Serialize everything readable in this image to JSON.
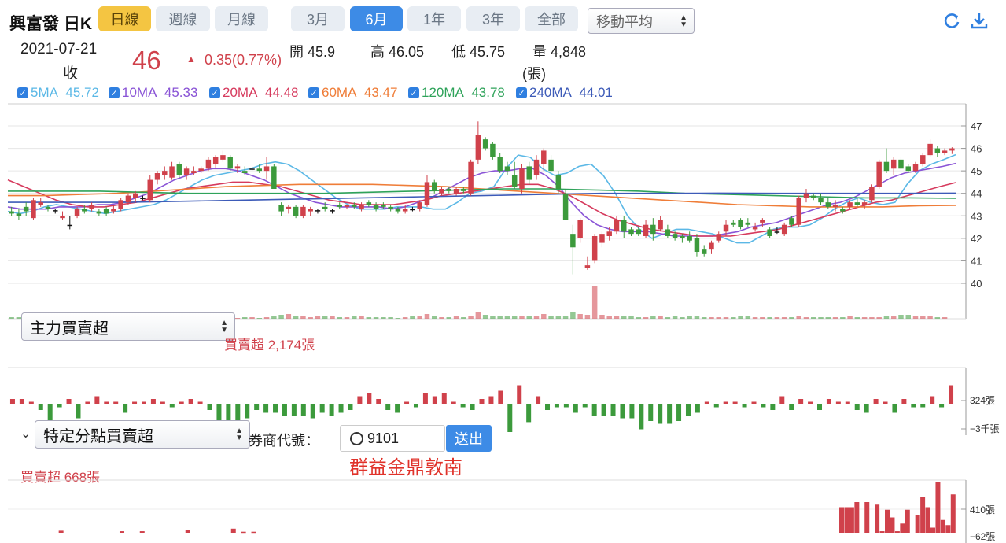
{
  "header": {
    "stock_name": "興富發 日K",
    "ranges": [
      "日線",
      "週線",
      "月線"
    ],
    "periods": [
      "3月",
      "6月",
      "1年",
      "3年",
      "全部"
    ],
    "indicator_select": "移動平均"
  },
  "quote": {
    "date": "2021-07-21",
    "close_label": "收",
    "price": "46",
    "change": "0.35(0.77%)",
    "open": "開 45.9",
    "high": "高 46.05",
    "low": "低 45.75",
    "volume": "量 4,848",
    "volume_unit": "(張)"
  },
  "ma_legend": [
    {
      "label": "5MA",
      "value": "45.72",
      "color": "#5bb8e6"
    },
    {
      "label": "10MA",
      "value": "45.33",
      "color": "#8a54d6"
    },
    {
      "label": "20MA",
      "value": "44.48",
      "color": "#d63a5d"
    },
    {
      "label": "60MA",
      "value": "43.47",
      "color": "#ef7d38"
    },
    {
      "label": "120MA",
      "value": "43.78",
      "color": "#2fa35a"
    },
    {
      "label": "240MA",
      "value": "44.01",
      "color": "#3d5bb8"
    }
  ],
  "price_axis": [
    "47",
    "46",
    "45",
    "44",
    "43",
    "42",
    "41",
    "40"
  ],
  "main_force": {
    "select": "主力買賣超",
    "summary": "買賣超 2,174張",
    "axis_top": "324張",
    "axis_bottom": "−3千張"
  },
  "branch": {
    "select": "特定分點買賣超",
    "broker_label": "券商代號：",
    "broker_code": "9101",
    "submit": "送出",
    "broker_name": "群益金鼎敦南",
    "summary": "買賣超 668張",
    "axis_top": "410張",
    "axis_bottom": "−62張"
  },
  "colors": {
    "up": "#d0414b",
    "down": "#3c9a3c",
    "accent": "#3d8be6"
  },
  "chart_data": {
    "type": "candlestick",
    "ylim": [
      40,
      47
    ],
    "candles": [
      [
        43.2,
        43.4,
        43.0,
        43.1
      ],
      [
        43.1,
        43.3,
        42.8,
        43.0
      ],
      [
        43.4,
        43.6,
        43.0,
        43.2
      ],
      [
        42.9,
        43.8,
        42.8,
        43.7
      ],
      [
        43.5,
        43.8,
        43.4,
        43.6
      ],
      [
        43.4,
        43.5,
        43.2,
        43.3
      ],
      [
        43.2,
        43.3,
        43.1,
        43.25
      ],
      [
        42.9,
        43.2,
        42.8,
        43.0
      ],
      [
        42.6,
        43.0,
        42.4,
        42.6
      ],
      [
        43.0,
        43.4,
        42.9,
        43.3
      ],
      [
        43.3,
        43.5,
        43.1,
        43.2
      ],
      [
        43.3,
        43.6,
        43.2,
        43.5
      ],
      [
        43.2,
        43.3,
        43.0,
        43.1
      ],
      [
        43.3,
        43.4,
        43.0,
        43.1
      ],
      [
        43.2,
        43.5,
        43.1,
        43.3
      ],
      [
        43.3,
        43.8,
        43.2,
        43.7
      ],
      [
        43.6,
        44.0,
        43.5,
        43.9
      ],
      [
        43.8,
        44.1,
        43.6,
        44.0
      ],
      [
        43.8,
        43.9,
        43.7,
        43.8
      ],
      [
        43.7,
        44.8,
        43.6,
        44.6
      ],
      [
        44.6,
        45.0,
        44.4,
        44.9
      ],
      [
        44.8,
        45.2,
        44.6,
        45.0
      ],
      [
        44.7,
        45.4,
        44.6,
        45.2
      ],
      [
        45.3,
        45.4,
        44.7,
        44.8
      ],
      [
        44.8,
        45.2,
        44.6,
        45.1
      ],
      [
        44.9,
        45.2,
        44.8,
        45.0
      ],
      [
        45.0,
        45.2,
        44.9,
        45.1
      ],
      [
        45.1,
        45.6,
        45.0,
        45.5
      ],
      [
        45.3,
        45.7,
        45.1,
        45.6
      ],
      [
        45.5,
        45.9,
        45.4,
        45.7
      ],
      [
        45.6,
        45.7,
        45.0,
        45.1
      ],
      [
        45.1,
        45.3,
        44.9,
        45.2
      ],
      [
        45.0,
        45.2,
        44.8,
        44.9
      ],
      [
        45.1,
        45.2,
        45.0,
        45.1
      ],
      [
        45.1,
        45.3,
        44.9,
        45.0
      ],
      [
        45.0,
        45.6,
        44.6,
        45.2
      ],
      [
        45.2,
        45.3,
        44.2,
        44.2
      ],
      [
        43.5,
        43.6,
        43.0,
        43.2
      ],
      [
        43.3,
        43.5,
        43.1,
        43.4
      ],
      [
        43.4,
        43.5,
        42.9,
        43.0
      ],
      [
        43.0,
        43.5,
        42.9,
        43.4
      ],
      [
        43.2,
        43.4,
        43.0,
        43.3
      ],
      [
        43.2,
        43.3,
        43.1,
        43.25
      ],
      [
        43.4,
        43.6,
        43.2,
        43.3
      ],
      [
        43.2,
        43.3,
        43.1,
        43.25
      ],
      [
        43.5,
        43.6,
        43.3,
        43.4
      ],
      [
        43.4,
        43.5,
        43.3,
        43.5
      ],
      [
        43.5,
        43.6,
        43.3,
        43.4
      ],
      [
        43.3,
        43.6,
        43.2,
        43.5
      ],
      [
        43.6,
        43.7,
        43.4,
        43.5
      ],
      [
        43.5,
        43.6,
        43.2,
        43.3
      ],
      [
        43.5,
        43.6,
        43.3,
        43.4
      ],
      [
        43.4,
        43.5,
        43.2,
        43.3
      ],
      [
        43.3,
        43.4,
        43.1,
        43.2
      ],
      [
        43.2,
        43.5,
        43.1,
        43.3
      ],
      [
        43.3,
        43.4,
        43.2,
        43.25
      ],
      [
        43.3,
        43.7,
        43.2,
        43.6
      ],
      [
        43.5,
        44.8,
        43.4,
        44.5
      ],
      [
        44.5,
        44.6,
        44.0,
        44.1
      ],
      [
        44.0,
        44.3,
        43.9,
        44.2
      ],
      [
        44.2,
        44.3,
        44.0,
        44.1
      ],
      [
        44.0,
        44.3,
        43.9,
        44.2
      ],
      [
        44.2,
        44.3,
        44.0,
        44.1
      ],
      [
        44.0,
        45.5,
        43.9,
        45.4
      ],
      [
        45.5,
        47.2,
        45.3,
        46.6
      ],
      [
        46.4,
        46.5,
        45.9,
        46.0
      ],
      [
        46.2,
        46.3,
        45.5,
        45.6
      ],
      [
        45.6,
        45.8,
        44.9,
        45.0
      ],
      [
        45.2,
        45.4,
        44.8,
        45.0
      ],
      [
        44.8,
        45.4,
        44.2,
        44.3
      ],
      [
        44.2,
        45.3,
        44.0,
        45.1
      ],
      [
        45.2,
        45.4,
        44.4,
        44.6
      ],
      [
        44.8,
        45.7,
        44.6,
        45.5
      ],
      [
        45.3,
        46.0,
        45.0,
        45.9
      ],
      [
        45.5,
        45.7,
        44.9,
        45.0
      ],
      [
        44.8,
        45.0,
        44.0,
        44.2
      ],
      [
        44.0,
        44.2,
        42.8,
        42.8
      ],
      [
        42.2,
        42.6,
        40.4,
        41.6
      ],
      [
        42.0,
        42.9,
        41.8,
        42.8
      ],
      [
        40.7,
        41.2,
        40.6,
        40.8
      ],
      [
        41.0,
        42.2,
        40.9,
        42.1
      ],
      [
        41.8,
        42.3,
        41.6,
        42.2
      ],
      [
        42.1,
        42.5,
        41.9,
        42.3
      ],
      [
        42.3,
        43.0,
        42.2,
        42.8
      ],
      [
        42.8,
        43.0,
        42.0,
        42.3
      ],
      [
        42.4,
        42.5,
        42.1,
        42.2
      ],
      [
        42.4,
        42.5,
        42.1,
        42.2
      ],
      [
        42.1,
        42.8,
        42.0,
        42.6
      ],
      [
        42.6,
        42.9,
        41.9,
        42.2
      ],
      [
        42.4,
        43.0,
        42.3,
        42.8
      ],
      [
        42.4,
        42.6,
        42.0,
        42.1
      ],
      [
        42.2,
        42.3,
        41.9,
        42.0
      ],
      [
        42.1,
        42.2,
        41.8,
        42.0
      ],
      [
        42.1,
        42.3,
        41.8,
        41.9
      ],
      [
        42.0,
        42.2,
        41.2,
        41.4
      ],
      [
        41.5,
        41.7,
        41.2,
        41.3
      ],
      [
        41.5,
        41.9,
        41.3,
        41.8
      ],
      [
        41.9,
        42.3,
        41.8,
        42.2
      ],
      [
        42.3,
        42.8,
        42.1,
        42.6
      ],
      [
        42.7,
        42.8,
        42.5,
        42.6
      ],
      [
        42.8,
        42.9,
        42.4,
        42.5
      ],
      [
        42.7,
        42.9,
        42.5,
        42.6
      ],
      [
        42.4,
        42.7,
        42.3,
        42.5
      ],
      [
        42.7,
        42.9,
        42.5,
        42.8
      ],
      [
        42.4,
        42.5,
        42.0,
        42.1
      ],
      [
        42.3,
        42.5,
        42.2,
        42.3
      ],
      [
        42.2,
        42.7,
        42.1,
        42.6
      ],
      [
        42.9,
        43.0,
        42.5,
        42.6
      ],
      [
        42.6,
        43.9,
        42.5,
        43.8
      ],
      [
        43.8,
        44.2,
        43.6,
        44.0
      ],
      [
        43.9,
        44.0,
        43.7,
        43.8
      ],
      [
        43.8,
        44.0,
        43.5,
        43.6
      ],
      [
        43.6,
        43.8,
        43.3,
        43.4
      ],
      [
        43.4,
        43.7,
        43.2,
        43.5
      ],
      [
        43.3,
        43.4,
        43.1,
        43.2
      ],
      [
        43.4,
        43.7,
        43.3,
        43.6
      ],
      [
        43.6,
        43.8,
        43.4,
        43.5
      ],
      [
        43.5,
        43.7,
        43.3,
        43.6
      ],
      [
        43.7,
        44.4,
        43.6,
        44.3
      ],
      [
        44.3,
        45.5,
        44.2,
        45.4
      ],
      [
        45.4,
        46.0,
        44.9,
        45.0
      ],
      [
        45.1,
        45.6,
        44.8,
        45.5
      ],
      [
        45.5,
        45.6,
        45.0,
        45.1
      ],
      [
        45.2,
        45.3,
        44.9,
        45.0
      ],
      [
        45.0,
        45.4,
        44.9,
        45.3
      ],
      [
        45.3,
        45.8,
        45.2,
        45.7
      ],
      [
        45.7,
        46.4,
        45.6,
        46.2
      ],
      [
        46.0,
        46.1,
        45.6,
        45.8
      ],
      [
        45.8,
        46.0,
        45.7,
        45.9
      ],
      [
        45.9,
        46.05,
        45.75,
        46.0
      ]
    ],
    "ma_lines": {
      "5MA": [
        43.2,
        43.1,
        43.2,
        43.4,
        43.5,
        43.4,
        43.3,
        43.2,
        43.1,
        43.2,
        43.3,
        43.4,
        43.5,
        43.7,
        44.0,
        44.3,
        44.6,
        44.8,
        44.9,
        45.0,
        45.1,
        45.3,
        45.4,
        45.3,
        45.0,
        44.6,
        44.2,
        43.8,
        43.5,
        43.3,
        43.3,
        43.3,
        43.4,
        43.4,
        43.4,
        43.3,
        43.3,
        43.6,
        44.0,
        44.1,
        44.3,
        45.1,
        45.7,
        45.6,
        45.1,
        44.8,
        44.9,
        45.2,
        45.3,
        44.8,
        44.0,
        43.0,
        42.4,
        42.0,
        42.2,
        42.4,
        42.4,
        42.3,
        42.2,
        42.0,
        41.8,
        41.8,
        42.1,
        42.4,
        42.5,
        42.5,
        42.6,
        42.9,
        43.3,
        43.6,
        43.8,
        43.6,
        43.5,
        43.6,
        44.4,
        45.0,
        45.3,
        45.5,
        45.72
      ],
      "10MA": [
        43.4,
        43.3,
        43.3,
        43.3,
        43.4,
        43.4,
        43.4,
        43.5,
        43.5,
        43.6,
        43.8,
        44.0,
        44.3,
        44.6,
        44.8,
        45.0,
        45.1,
        45.1,
        45.0,
        44.8,
        44.6,
        44.3,
        44.0,
        43.8,
        43.6,
        43.5,
        43.4,
        43.4,
        43.4,
        43.4,
        43.3,
        43.4,
        43.6,
        43.8,
        44.1,
        44.4,
        44.7,
        44.9,
        45.0,
        45.0,
        45.1,
        45.1,
        44.8,
        44.3,
        43.6,
        43.0,
        42.6,
        42.4,
        42.3,
        42.3,
        42.3,
        42.2,
        42.1,
        42.1,
        42.1,
        42.1,
        42.2,
        42.3,
        42.5,
        42.6,
        42.7,
        42.9,
        43.1,
        43.3,
        43.5,
        43.6,
        43.8,
        44.1,
        44.4,
        44.7,
        44.9,
        45.0,
        45.1,
        45.2,
        45.33
      ],
      "20MA": [
        44.6,
        44.3,
        44.0,
        43.7,
        43.5,
        43.4,
        43.4,
        43.5,
        43.6,
        43.8,
        44.0,
        44.2,
        44.3,
        44.4,
        44.5,
        44.5,
        44.4,
        44.3,
        44.1,
        43.9,
        43.7,
        43.6,
        43.5,
        43.5,
        43.5,
        43.6,
        43.7,
        43.9,
        44.0,
        44.1,
        44.2,
        44.3,
        44.4,
        44.4,
        44.2,
        43.9,
        43.5,
        43.1,
        42.8,
        42.6,
        42.4,
        42.3,
        42.2,
        42.1,
        42.1,
        42.1,
        42.2,
        42.3,
        42.4,
        42.6,
        42.8,
        43.0,
        43.2,
        43.4,
        43.6,
        43.7,
        43.9,
        44.1,
        44.3,
        44.48
      ],
      "60MA": [
        43.9,
        43.9,
        43.95,
        44.0,
        44.1,
        44.2,
        44.3,
        44.35,
        44.4,
        44.4,
        44.4,
        44.35,
        44.3,
        44.2,
        44.1,
        44.0,
        43.9,
        43.8,
        43.7,
        43.6,
        43.5,
        43.45,
        43.4,
        43.4,
        43.4,
        43.45,
        43.47
      ],
      "120MA": [
        44.1,
        44.1,
        44.1,
        44.05,
        44.0,
        44.0,
        44.0,
        44.0,
        44.05,
        44.1,
        44.15,
        44.2,
        44.2,
        44.15,
        44.1,
        44.0,
        43.95,
        43.9,
        43.85,
        43.8,
        43.8,
        43.78
      ],
      "240MA": [
        43.6,
        43.6,
        43.6,
        43.65,
        43.7,
        43.75,
        43.8,
        43.85,
        43.9,
        43.95,
        44.0,
        44.0,
        44.01,
        44.0,
        44.0,
        44.0,
        44.01
      ]
    },
    "volume": [
      2,
      2,
      1,
      2,
      3,
      2,
      1,
      2,
      3,
      2,
      2,
      1,
      1,
      2,
      2,
      1,
      2,
      3,
      2,
      3,
      4,
      6,
      4,
      3,
      2,
      2,
      2,
      2,
      4,
      3,
      2,
      1,
      2,
      2,
      1,
      2,
      3,
      5,
      6,
      3,
      3,
      2,
      4,
      3,
      3,
      2,
      2,
      3,
      3,
      2,
      2,
      2,
      2,
      1,
      2,
      3,
      4,
      6,
      3,
      2,
      2,
      3,
      2,
      4,
      8,
      5,
      4,
      3,
      3,
      4,
      3,
      3,
      4,
      6,
      4,
      3,
      4,
      8,
      6,
      5,
      42,
      5,
      4,
      3,
      3,
      3,
      2,
      2,
      3,
      3,
      2,
      3,
      2,
      3,
      3,
      2,
      2,
      2,
      2,
      2,
      3,
      3,
      2,
      2,
      2,
      2,
      2,
      2,
      3,
      2,
      2,
      2,
      2,
      2,
      2,
      3,
      2,
      2,
      2,
      2,
      3,
      4,
      5,
      5,
      3,
      3,
      3,
      2,
      2
    ],
    "main_force_net": [
      1,
      1,
      0.5,
      -1,
      -3,
      -0.5,
      1,
      -2.5,
      0.5,
      1.5,
      0.5,
      0.5,
      -1.5,
      0.5,
      0.5,
      1,
      0.5,
      -0.5,
      0.5,
      1,
      0.5,
      -1,
      -5,
      -4.5,
      -4,
      -2.5,
      -1,
      -1.5,
      -1.5,
      -2,
      -2,
      -2,
      -2.5,
      -1.5,
      -2,
      -1.5,
      -1,
      1.5,
      2,
      1,
      -1,
      -1.5,
      0.5,
      -0.5,
      2,
      1.5,
      2,
      0.5,
      -0.5,
      -1,
      1,
      1.5,
      2.5,
      -5,
      3.5,
      -3.2,
      1.5,
      -1,
      -0.5,
      -0.5,
      -1.5,
      -0.5,
      -2,
      -2,
      -2,
      -2.5,
      -2.5,
      -4.5,
      -3,
      -3.5,
      -3.5,
      -3,
      -2,
      -1.5,
      0.5,
      -0.5,
      0.5,
      0.5,
      -0.5,
      0.5,
      -0.5,
      -1,
      1.5,
      -1,
      1,
      0.5,
      -1,
      1,
      0.5,
      0.5,
      -1,
      -1.5,
      1,
      0.5,
      -1.5,
      1,
      -0.5,
      -0.5,
      1.5,
      -0.5,
      3.5
    ],
    "branch_net": [
      0,
      0,
      0,
      0,
      0,
      0,
      0,
      0,
      0,
      0,
      0.4,
      0,
      0,
      0,
      0,
      0,
      0,
      0,
      0,
      0,
      0,
      0,
      0.3,
      0,
      0,
      0,
      0.3,
      0,
      0,
      0,
      0,
      0,
      0,
      0,
      0,
      0.5,
      0,
      0,
      0,
      0,
      0,
      0,
      0,
      0,
      0.8,
      0,
      0.2,
      0,
      0.2,
      0,
      0,
      0,
      0,
      0,
      0,
      0,
      0,
      0,
      0,
      0,
      0,
      0,
      0,
      0,
      0,
      0,
      0,
      0,
      0,
      0,
      0,
      0,
      0,
      0,
      0,
      0,
      0,
      0,
      0,
      0,
      0,
      0,
      0,
      0,
      0,
      0,
      0,
      0,
      0,
      0,
      0,
      0,
      0,
      0,
      0,
      0,
      0,
      0,
      0,
      0,
      0,
      0,
      0,
      0,
      0,
      0,
      0,
      0,
      0,
      0,
      0,
      0,
      0,
      0,
      0,
      0,
      0,
      0,
      0,
      0,
      0,
      0,
      0,
      0,
      0,
      0,
      0,
      0,
      0,
      0,
      0,
      0,
      0,
      0,
      0,
      0,
      0,
      0,
      0,
      0,
      0,
      0,
      0,
      0,
      0,
      0,
      0,
      0,
      0,
      0,
      0,
      0,
      0,
      0,
      0,
      0,
      0,
      0,
      0,
      0,
      0,
      0,
      0,
      0,
      5,
      5,
      5,
      6,
      0,
      6,
      0,
      5.5,
      0.3,
      4.5,
      3,
      0.3,
      1.8,
      4.5,
      0,
      3.5,
      7,
      5,
      1,
      10,
      2.5,
      1.5,
      7.5
    ]
  }
}
